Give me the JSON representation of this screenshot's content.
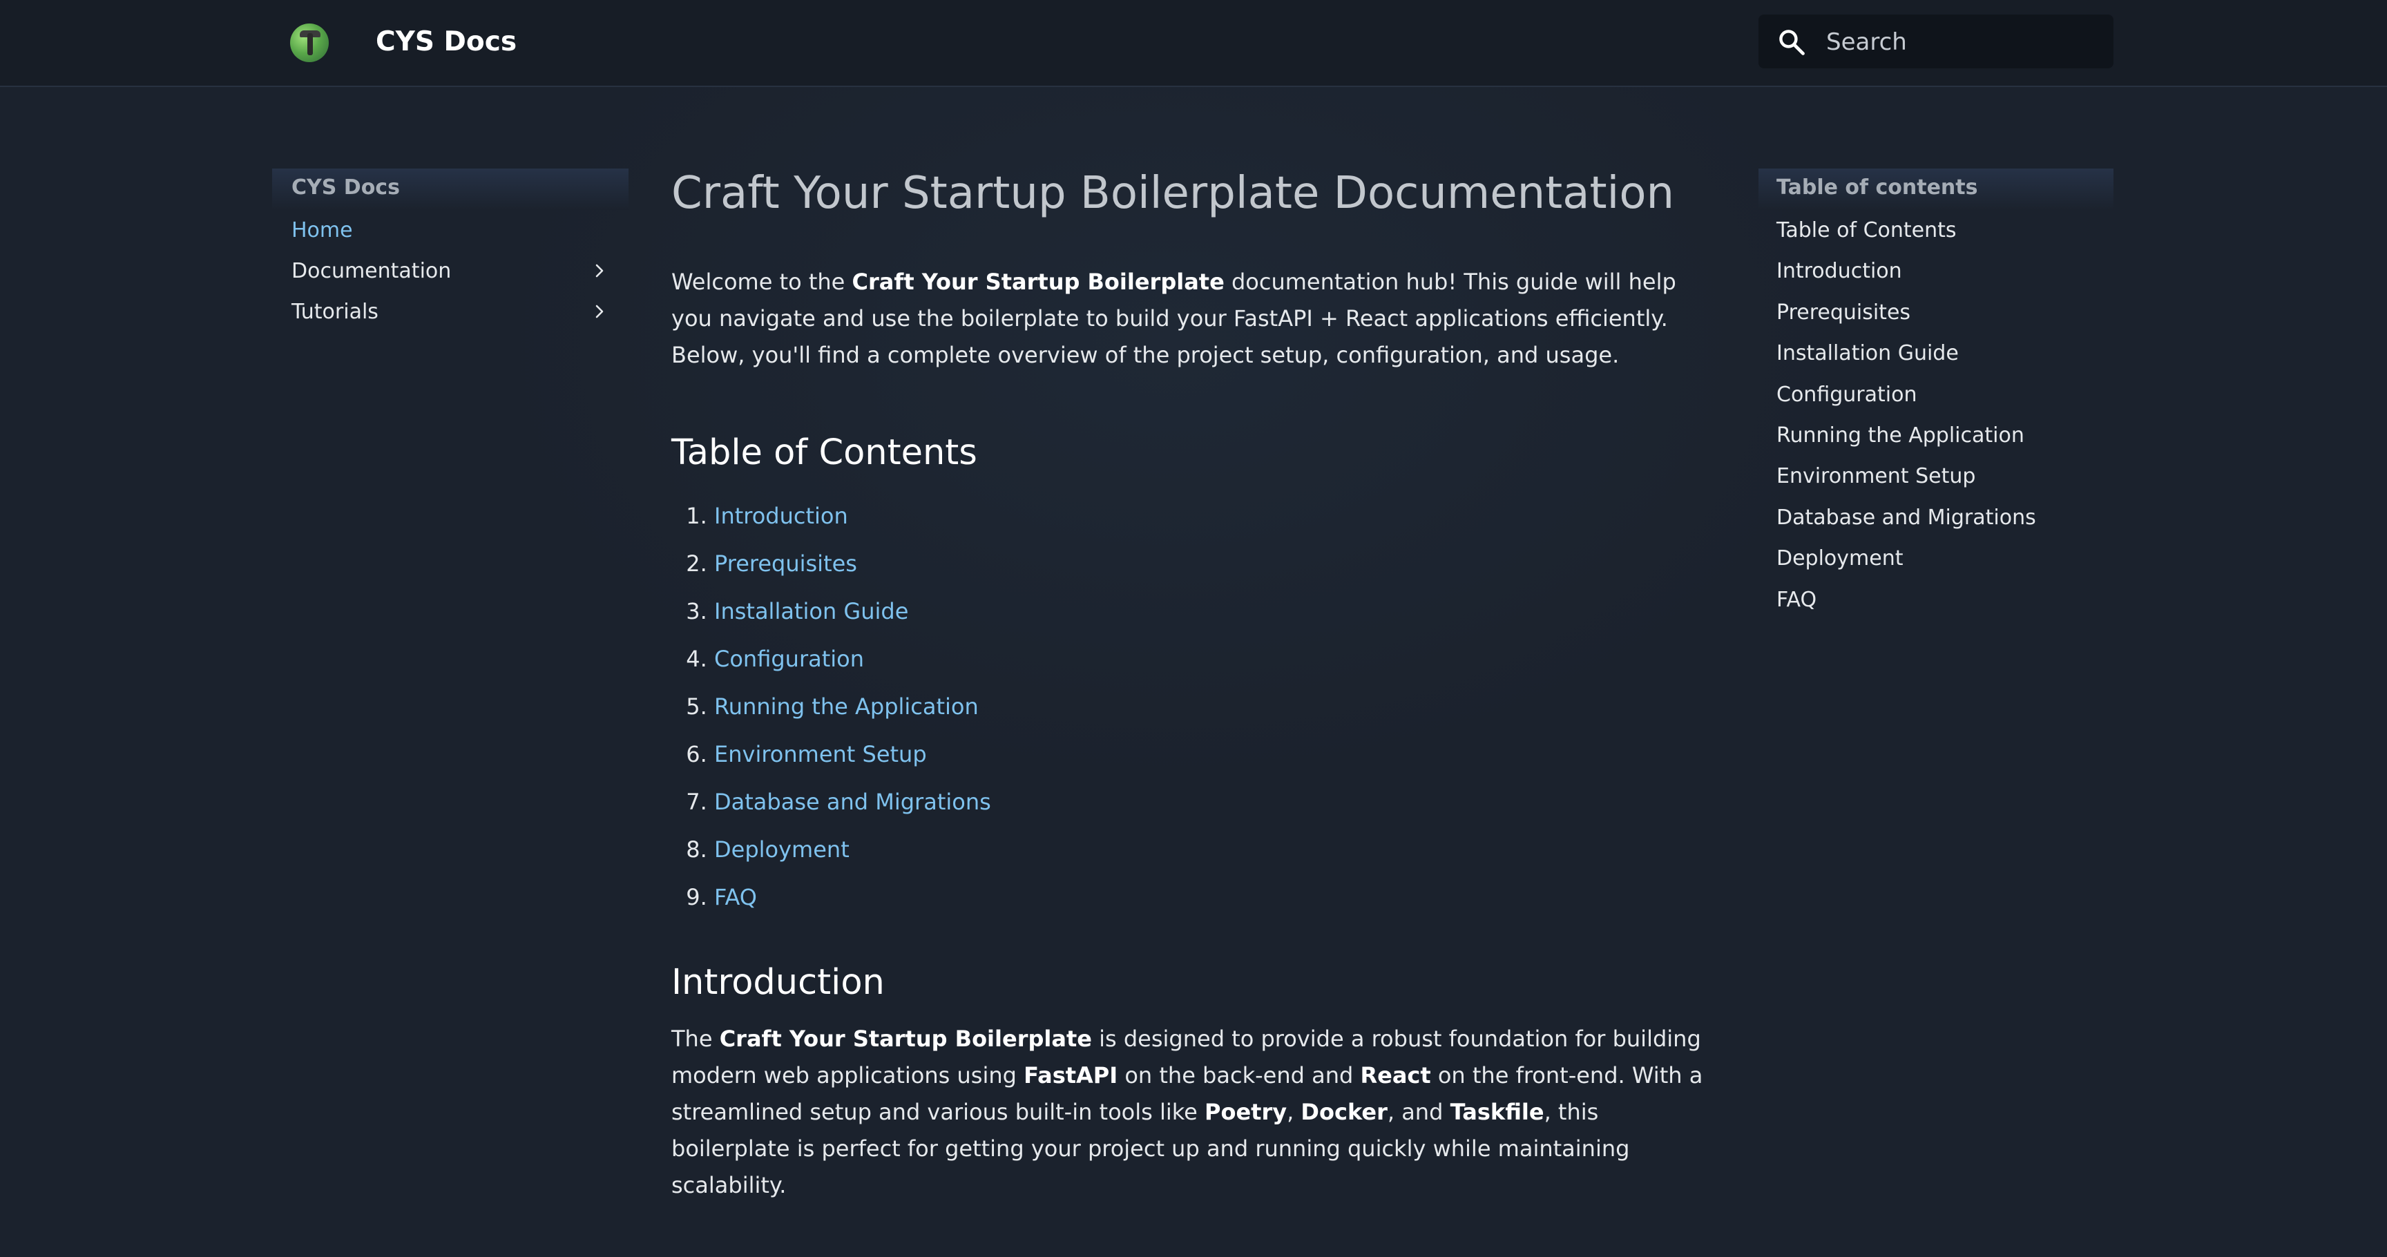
{
  "header": {
    "site_title": "CYS Docs",
    "search_placeholder": "Search",
    "search_icon": "search-icon",
    "logo_icon": "mushroom-logo"
  },
  "sidebar": {
    "heading": "CYS Docs",
    "items": [
      {
        "label": "Home",
        "active": true
      },
      {
        "label": "Documentation",
        "expandable": true
      },
      {
        "label": "Tutorials",
        "expandable": true
      }
    ]
  },
  "main": {
    "title": "Craft Your Startup Boilerplate Documentation",
    "intro": {
      "pre": "Welcome to the ",
      "bold": "Craft Your Startup Boilerplate",
      "post": " documentation hub! This guide will help you navigate and use the boilerplate to build your FastAPI + React applications efficiently. Below, you'll find a complete overview of the project setup, configuration, and usage."
    },
    "toc_heading": "Table of Contents",
    "toc_items": [
      "Introduction",
      "Prerequisites",
      "Installation Guide",
      "Configuration",
      "Running the Application",
      "Environment Setup",
      "Database and Migrations",
      "Deployment",
      "FAQ"
    ],
    "introduction_heading": "Introduction",
    "introduction": {
      "t1": "The ",
      "b1": "Craft Your Startup Boilerplate",
      "t2": " is designed to provide a robust foundation for building modern web applications using ",
      "b2": "FastAPI",
      "t3": " on the back-end and ",
      "b3": "React",
      "t4": " on the front-end. With a streamlined setup and various built-in tools like ",
      "b4": "Poetry",
      "t5": ", ",
      "b5": "Docker",
      "t6": ", and ",
      "b6": "Taskfile",
      "t7": ", this boilerplate is perfect for getting your project up and running quickly while maintaining scalability."
    }
  },
  "right_toc": {
    "heading": "Table of contents",
    "items": [
      "Table of Contents",
      "Introduction",
      "Prerequisites",
      "Installation Guide",
      "Configuration",
      "Running the Application",
      "Environment Setup",
      "Database and Migrations",
      "Deployment",
      "FAQ"
    ]
  },
  "colors": {
    "link": "#7fc2ee",
    "background": "#1b222d",
    "header_bg": "#171d26"
  }
}
